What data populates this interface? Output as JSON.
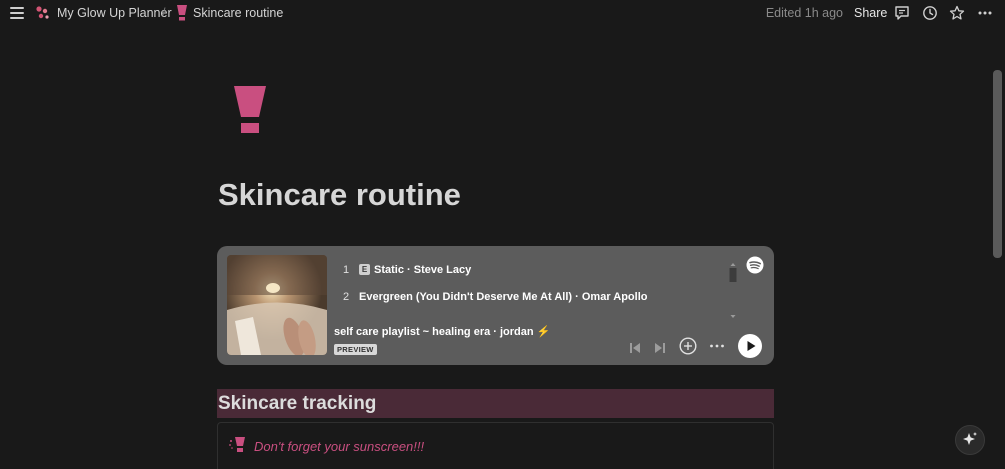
{
  "topbar": {
    "breadcrumb": [
      {
        "label": "My Glow Up Planner",
        "icon": "cherry-blossom-icon"
      },
      {
        "label": "Skincare routine",
        "icon": "lotion-bottle-icon"
      }
    ],
    "separator": "/",
    "edited": "Edited 1h ago",
    "share_label": "Share",
    "icons": [
      "menu-icon",
      "comment-icon",
      "history-icon",
      "star-icon",
      "more-icon"
    ]
  },
  "page": {
    "icon": "lotion-bottle-icon",
    "title": "Skincare routine"
  },
  "spotify": {
    "tracks": [
      {
        "number": "1",
        "explicit": true,
        "explicit_label": "E",
        "title": "Static",
        "separator": " · ",
        "artist": "Steve Lacy"
      },
      {
        "number": "2",
        "explicit": false,
        "title": "Evergreen (You Didn't Deserve Me At All)",
        "separator": " · ",
        "artist": "Omar Apollo"
      }
    ],
    "playlist": "self care playlist ~ healing era · jordan ⚡",
    "preview_label": "PREVIEW",
    "icons": [
      "spotify-logo-icon",
      "previous-track-icon",
      "next-track-icon",
      "add-to-library-icon",
      "more-options-icon",
      "play-icon"
    ]
  },
  "tracking": {
    "heading": "Skincare tracking",
    "callout_text": "Don't forget your sunscreen!!!",
    "callout_icon": "lotion-bottle-icon"
  },
  "colors": {
    "background": "#191919",
    "accent_pink": "#c94f80",
    "heading_bg": "#4a2a37",
    "embed_bg": "#5c5c5c"
  }
}
